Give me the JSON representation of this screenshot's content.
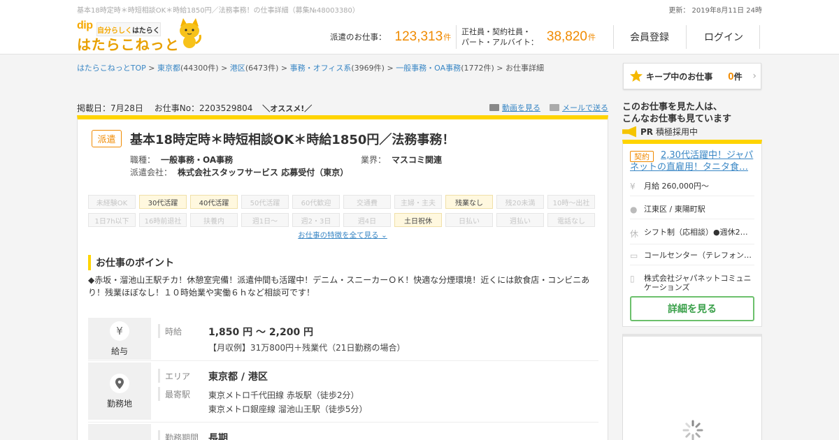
{
  "header": {
    "page_heading": "基本18時定時＊時短相談OK＊時給1850円／法務事務！の仕事詳細（募集№48003380）",
    "updated": "更新： 2019年8月11日 24時",
    "logo": {
      "brand": "dip",
      "tagline_a": "自分らしく",
      "tagline_b": "はたらく",
      "name": "はたらこねっと"
    },
    "stat_dispatch_label": "派遣のお仕事：",
    "stat_dispatch_value": "123,313",
    "stat_dispatch_unit": "件",
    "stat_regular_label": "正社員・契約社員・\nパート・アルバイト：",
    "stat_regular_value": "38,820",
    "stat_regular_unit": "件",
    "register": "会員登録",
    "login": "ログイン"
  },
  "breadcrumb": [
    {
      "text": "はたらこねっとTOP",
      "link": true
    },
    {
      "text": " > ",
      "link": false
    },
    {
      "text": "東京都",
      "link": true
    },
    {
      "text": "(44300件) > ",
      "link": false
    },
    {
      "text": "港区",
      "link": true
    },
    {
      "text": "(6473件) > ",
      "link": false
    },
    {
      "text": "事務・オフィス系",
      "link": true
    },
    {
      "text": "(3969件) > ",
      "link": false
    },
    {
      "text": "一般事務・OA事務",
      "link": true
    },
    {
      "text": "(1772件) > お仕事詳細",
      "link": false
    }
  ],
  "meta": {
    "posted": "掲載日：7月28日",
    "job_no": "お仕事No：2203529804",
    "recommend": "＼オススメ!／",
    "video": "動画を見る",
    "mail": "メールで送る"
  },
  "job": {
    "badge": "派遣",
    "title": "基本18時定時＊時短相談OK＊時給1850円／法務事務！",
    "occupation_label": "職種：",
    "occupation": "一般事務・OA事務",
    "industry_label": "業界：",
    "industry": "マスコミ関連",
    "agency_label": "派遣会社：",
    "agency": "株式会社スタッフサービス 応募受付（東京）"
  },
  "features": [
    {
      "label": "未経験OK",
      "on": false
    },
    {
      "label": "30代活躍",
      "on": true
    },
    {
      "label": "40代活躍",
      "on": true
    },
    {
      "label": "50代活躍",
      "on": false
    },
    {
      "label": "60代歓迎",
      "on": false
    },
    {
      "label": "交通費",
      "on": false
    },
    {
      "label": "主婦・主夫",
      "on": false
    },
    {
      "label": "残業なし",
      "on": true
    },
    {
      "label": "残20未満",
      "on": false
    },
    {
      "label": "10時～出社",
      "on": false
    },
    {
      "label": "1日7h以下",
      "on": false
    },
    {
      "label": "16時前退社",
      "on": false
    },
    {
      "label": "扶養内",
      "on": false
    },
    {
      "label": "週1日～",
      "on": false
    },
    {
      "label": "週2・3日",
      "on": false
    },
    {
      "label": "週4日",
      "on": false
    },
    {
      "label": "土日祝休",
      "on": true
    },
    {
      "label": "日払い",
      "on": false
    },
    {
      "label": "週払い",
      "on": false
    },
    {
      "label": "電話なし",
      "on": false
    }
  ],
  "features_more": "お仕事の特徴を全て見る",
  "point": {
    "heading": "お仕事のポイント",
    "text": "◆赤坂・溜池山王駅チカ！休憩室完備！派遣仲間も活躍中！デニム・スニーカーＯＫ！快適な分煙環境！近くには飲食店・コンビニあり！残業ほぼなし！１０時始業や実働６ｈなど相談可です！"
  },
  "details": {
    "salary": {
      "icon": "¥",
      "title": "給与",
      "label": "時給",
      "value": "1,850 円 ～ 2,200 円",
      "note": "【月収例】31万800円＋残業代（21日勤務の場合）"
    },
    "location": {
      "title": "勤務地",
      "area_label": "エリア",
      "area": "東京都 / 港区",
      "station_label": "最寄駅",
      "station1": "東京メトロ千代田線 赤坂駅（徒歩2分）",
      "station2": "東京メトロ銀座線 溜池山王駅（徒歩5分）"
    },
    "period": {
      "label": "勤務期間",
      "value": "長期"
    }
  },
  "sidebar": {
    "keep_label": "キープ中のお仕事",
    "keep_count": "0",
    "keep_unit": "件",
    "seen_heading": "このお仕事を見た人は、\nこんなお仕事も見ています",
    "pr_label": "PR",
    "pr_text": "積極採用中",
    "rec": {
      "badge": "契約",
      "title": "2,30代活躍中！ジャパネットの直雇用！タニタ食…",
      "salary": "月給 260,000円～",
      "location": "江東区 / 東陽町駅",
      "shift": "シフト制（応相談）●週休2日…",
      "job": "コールセンター（テレフォン…",
      "company": "株式会社ジャパネットコミュニケーションズ",
      "button": "詳細を見る"
    }
  }
}
